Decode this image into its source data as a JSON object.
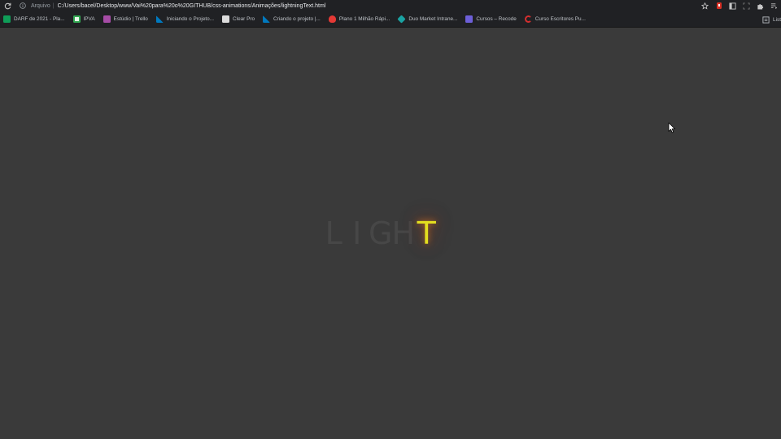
{
  "browser": {
    "address": {
      "scheme_label": "Arquivo",
      "separator": "|",
      "url": "C:/Users/bacel/Desktop/www/Vai%20para%20o%20GITHUB/css-animations/Animações/lightningText.html"
    },
    "right_icons": [
      "star-icon",
      "extension-red-icon",
      "reading-list-icon",
      "screenshot-icon",
      "puzzle-icon",
      "playlist-icon"
    ],
    "bookmarks": [
      {
        "label": "DARF de 2021 - Pla...",
        "icon": "spreadsheet-icon",
        "color": "#0f9d58"
      },
      {
        "label": "IPVA",
        "icon": "ipva-icon",
        "color": "#34a853"
      },
      {
        "label": "Estúdio | Trello",
        "icon": "trello-icon",
        "color": "#a64ca6"
      },
      {
        "label": "Iniciando o Projeto...",
        "icon": "trello-blue-icon",
        "color": "#0079bf"
      },
      {
        "label": "Clear Pro",
        "icon": "clear-icon",
        "color": "#dcdcdc"
      },
      {
        "label": "Criando o projeto |...",
        "icon": "trello-blue-icon",
        "color": "#0079bf"
      },
      {
        "label": "Plano 1 Milhão Rápi...",
        "icon": "flame-icon",
        "color": "#e53935"
      },
      {
        "label": "Duo Market Intrane...",
        "icon": "duo-icon",
        "color": "#1aa3a3"
      },
      {
        "label": "Cursos – Recode",
        "icon": "recode-icon",
        "color": "#6d5fd8"
      },
      {
        "label": "Curso Escritores Pu...",
        "icon": "c-icon",
        "color": "#d32f2f"
      }
    ],
    "list_label": "List"
  },
  "page": {
    "letters": [
      "L",
      "I",
      "G",
      "H",
      "T"
    ],
    "lit_index": 4,
    "colors": {
      "background": "#3a3a3a",
      "dim_letter": "#474747",
      "lit_letter": "#e3df1f",
      "glow": "#e6781e"
    }
  }
}
